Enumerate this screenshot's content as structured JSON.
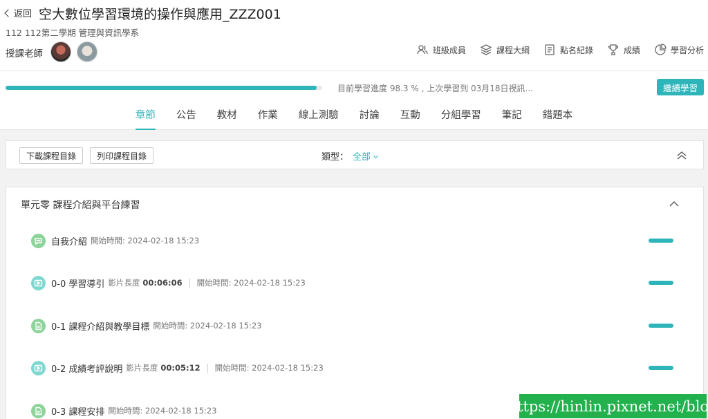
{
  "header": {
    "back_label": "返回",
    "course_title": "空大數位學習環境的操作與應用_ZZZ001",
    "term": "112 112第二學期 管理與資訊學系",
    "teacher_label": "授課老師"
  },
  "tools": [
    {
      "label": "班級成員",
      "icon": "members-icon"
    },
    {
      "label": "課程大綱",
      "icon": "layers-icon"
    },
    {
      "label": "點名紀錄",
      "icon": "document-icon"
    },
    {
      "label": "成績",
      "icon": "trophy-icon"
    },
    {
      "label": "學習分析",
      "icon": "pie-chart-icon"
    }
  ],
  "progress": {
    "percent": 98.3,
    "text": "目前學習進度 98.3 % , 上次學習到 03月18日視訊...",
    "continue_label": "繼續學習"
  },
  "tabs": [
    "章節",
    "公告",
    "教材",
    "作業",
    "線上測驗",
    "討論",
    "互動",
    "分組學習",
    "筆記",
    "錯題本"
  ],
  "active_tab": "章節",
  "toolbar": {
    "download_label": "下載課程目錄",
    "print_label": "列印課程目錄",
    "type_label": "類型：",
    "type_value": "全部"
  },
  "unit": {
    "title": "單元零 課程介紹與平台練習",
    "items": [
      {
        "name": "自我介紹",
        "icon": "chat-icon",
        "duration_label": "",
        "duration": "",
        "start_label": "開始時間:",
        "start": "2024-02-18 15:23",
        "status": "completed"
      },
      {
        "name": "0-0 學習導引",
        "icon": "play-icon",
        "duration_label": "影片長度",
        "duration": "00:06:06",
        "start_label": "開始時間:",
        "start": "2024-02-18 15:23",
        "status": "completed"
      },
      {
        "name": "0-1 課程介紹與教學目標",
        "icon": "file-icon",
        "duration_label": "",
        "duration": "",
        "start_label": "開始時間:",
        "start": "2024-02-18 15:23",
        "status": "completed"
      },
      {
        "name": "0-2 成績考評說明",
        "icon": "play-icon",
        "duration_label": "影片長度",
        "duration": "00:05:12",
        "start_label": "開始時間:",
        "start": "2024-02-18 15:23",
        "status": "completed"
      },
      {
        "name": "0-3 課程安排",
        "icon": "file-icon",
        "duration_label": "",
        "duration": "",
        "start_label": "開始時間:",
        "start": "2024-02-18 15:23",
        "status": "completed"
      }
    ]
  },
  "watermark": "https://hinlin.pixnet.net/blog",
  "colors": {
    "accent": "#2db5b9",
    "icon_green": "#8dd49a",
    "icon_teal": "#7fd8d0",
    "watermark_bg": "#22b14c"
  }
}
